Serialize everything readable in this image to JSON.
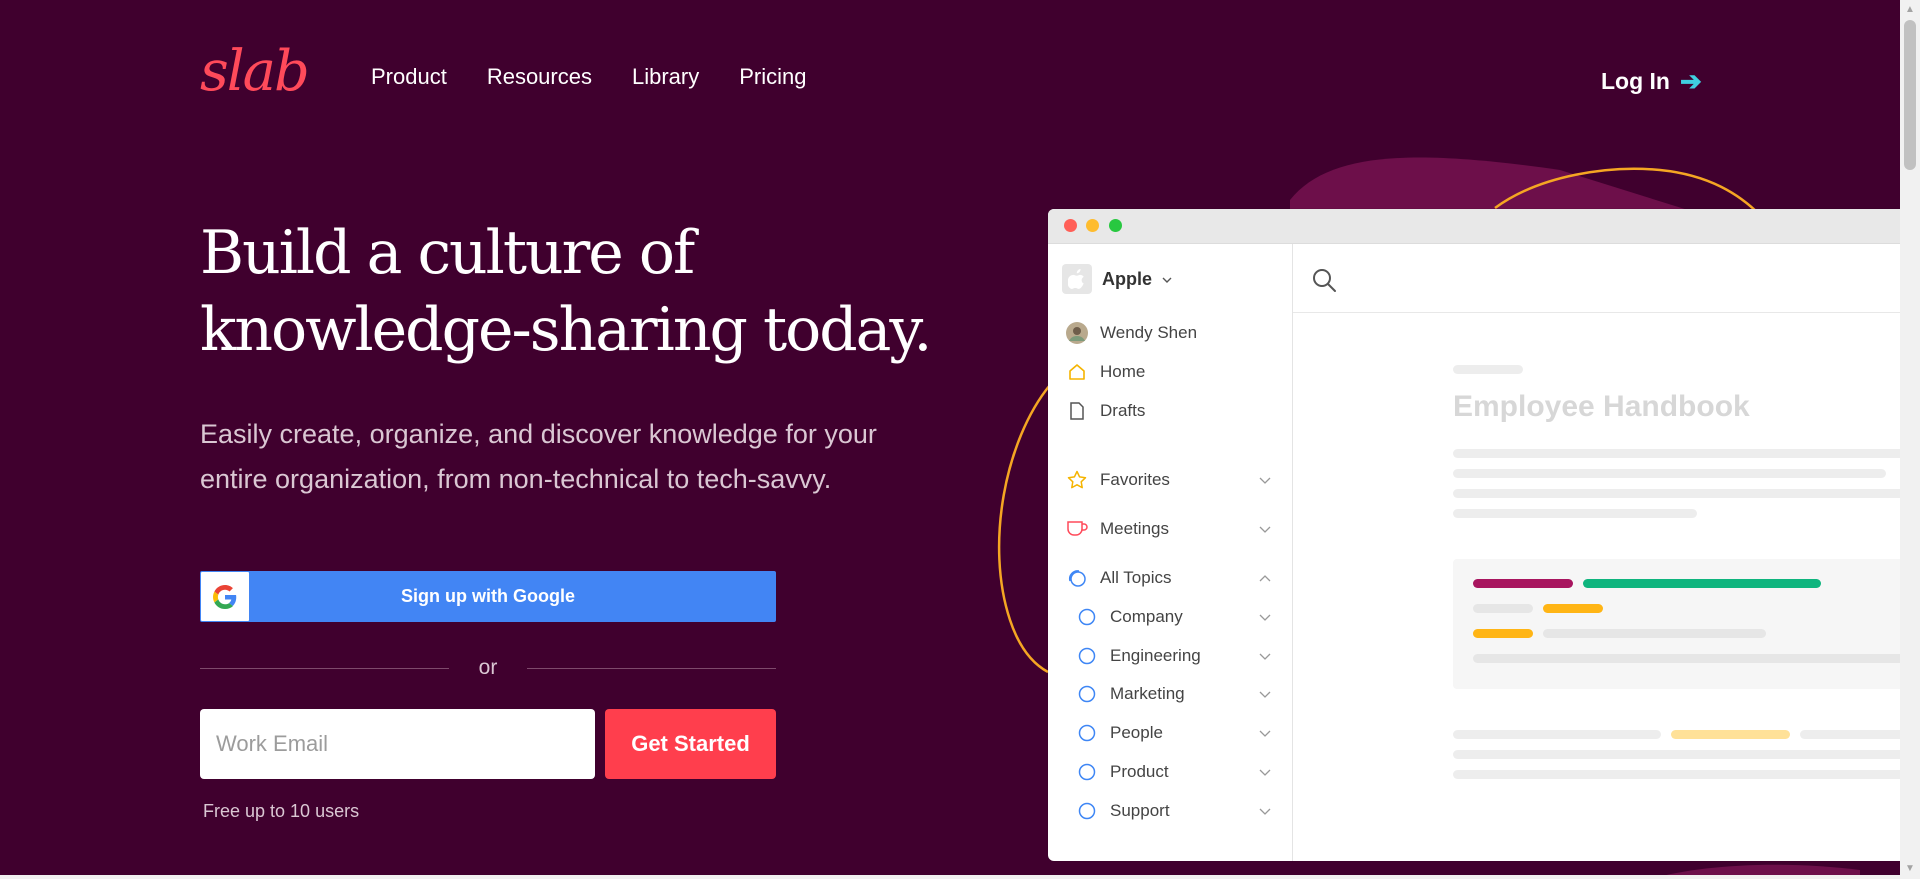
{
  "brand": {
    "logo_text": "slab",
    "accent": "#ff4a5a",
    "background": "#40002e"
  },
  "nav": {
    "items": [
      {
        "label": "Product"
      },
      {
        "label": "Resources"
      },
      {
        "label": "Library"
      },
      {
        "label": "Pricing"
      }
    ],
    "login": {
      "label": "Log In",
      "arrow": "➔"
    }
  },
  "hero": {
    "headline_line1": "Build a culture of",
    "headline_line2": "knowledge-sharing today.",
    "subtext": "Easily create, organize, and discover knowledge for your entire organization, from non-technical to tech-savvy."
  },
  "signup": {
    "google_label": "Sign up with Google",
    "google_color": "#4285f4",
    "or_label": "or",
    "email_placeholder": "Work Email",
    "email_value": "",
    "cta_label": "Get Started",
    "cta_color": "#ff3e4d",
    "free_note": "Free up to 10 users"
  },
  "app": {
    "org": {
      "name": "Apple",
      "icon": "apple-logo-icon"
    },
    "user": {
      "name": "Wendy Shen"
    },
    "items": [
      {
        "label": "Home",
        "icon": "home-icon"
      },
      {
        "label": "Drafts",
        "icon": "draft-icon"
      }
    ],
    "sections": [
      {
        "label": "Favorites",
        "icon": "star-icon"
      },
      {
        "label": "Meetings",
        "icon": "cup-icon"
      },
      {
        "label": "All Topics",
        "icon": "topics-icon"
      }
    ],
    "topics": [
      {
        "label": "Company"
      },
      {
        "label": "Engineering"
      },
      {
        "label": "Marketing"
      },
      {
        "label": "People"
      },
      {
        "label": "Product"
      },
      {
        "label": "Support"
      }
    ],
    "document": {
      "title": "Employee Handbook"
    },
    "colors": {
      "magenta": "#a8155f",
      "green": "#0fb57e",
      "yellow": "#ffb515",
      "light_yellow": "#ffe198",
      "topic_blue": "#3e86f5"
    }
  }
}
